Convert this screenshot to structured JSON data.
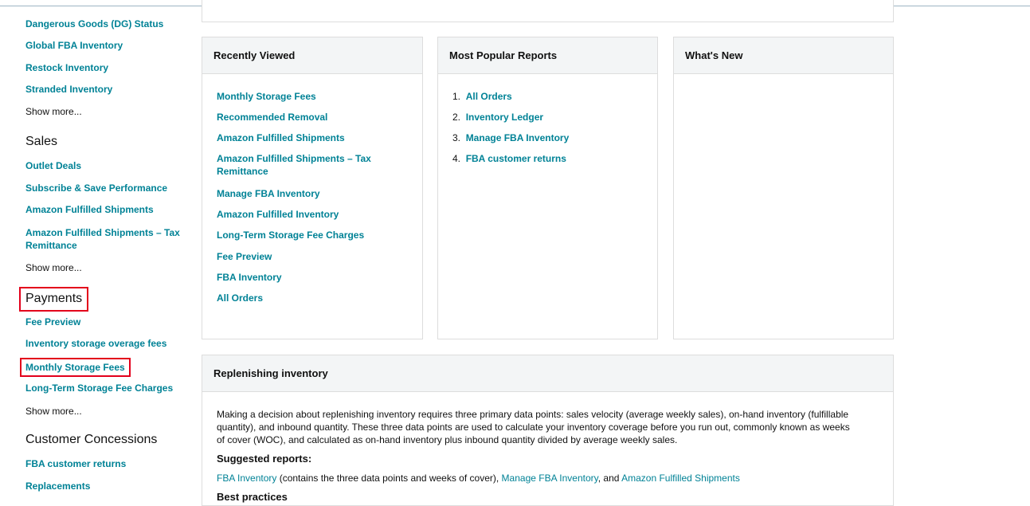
{
  "sidebar": {
    "inventory_links": [
      "Dangerous Goods (DG) Status",
      "Global FBA Inventory",
      "Restock Inventory",
      "Stranded Inventory"
    ],
    "inventory_more": "Show more...",
    "sales_title": "Sales",
    "sales_links": [
      "Outlet Deals",
      "Subscribe & Save Performance",
      "Amazon Fulfilled Shipments",
      "Amazon Fulfilled Shipments – Tax",
      "Remittance"
    ],
    "sales_more": "Show more...",
    "payments_title": "Payments",
    "payments_links": [
      "Fee Preview",
      "Inventory storage overage fees",
      "Monthly Storage Fees",
      "Long-Term Storage Fee Charges"
    ],
    "payments_more": "Show more...",
    "concessions_title": "Customer Concessions",
    "concessions_links": [
      "FBA customer returns",
      "Replacements"
    ]
  },
  "recently_viewed": {
    "title": "Recently Viewed",
    "items": [
      "Monthly Storage Fees",
      "Recommended Removal",
      "Amazon Fulfilled Shipments",
      "Amazon Fulfilled Shipments – Tax",
      "Remittance",
      "Manage FBA Inventory",
      "Amazon Fulfilled Inventory",
      "Long-Term Storage Fee Charges",
      "Fee Preview",
      "FBA Inventory",
      "All Orders"
    ]
  },
  "popular_reports": {
    "title": "Most Popular Reports",
    "items": [
      {
        "num": "1.",
        "label": "All Orders"
      },
      {
        "num": "2.",
        "label": "Inventory Ledger"
      },
      {
        "num": "3.",
        "label": "Manage FBA Inventory"
      },
      {
        "num": "4.",
        "label": "FBA customer returns"
      }
    ]
  },
  "whats_new": {
    "title": "What's New"
  },
  "replenishing": {
    "title": "Replenishing inventory",
    "text": "Making a decision about replenishing inventory requires three primary data points: sales velocity (average weekly sales), on-hand inventory (fulfillable quantity), and inbound quantity. These three data points are used to calculate your inventory coverage before you run out, commonly known as weeks of cover (WOC), and calculated as on-hand inventory plus inbound quantity divided by average weekly sales.",
    "suggested_label": "Suggested reports:",
    "link1": "FBA Inventory",
    "link1_desc": " (contains the three data points and weeks of cover), ",
    "link2": "Manage FBA Inventory",
    "connector": ", and ",
    "link3": "Amazon Fulfilled Shipments",
    "cut_heading": "Best practices"
  }
}
